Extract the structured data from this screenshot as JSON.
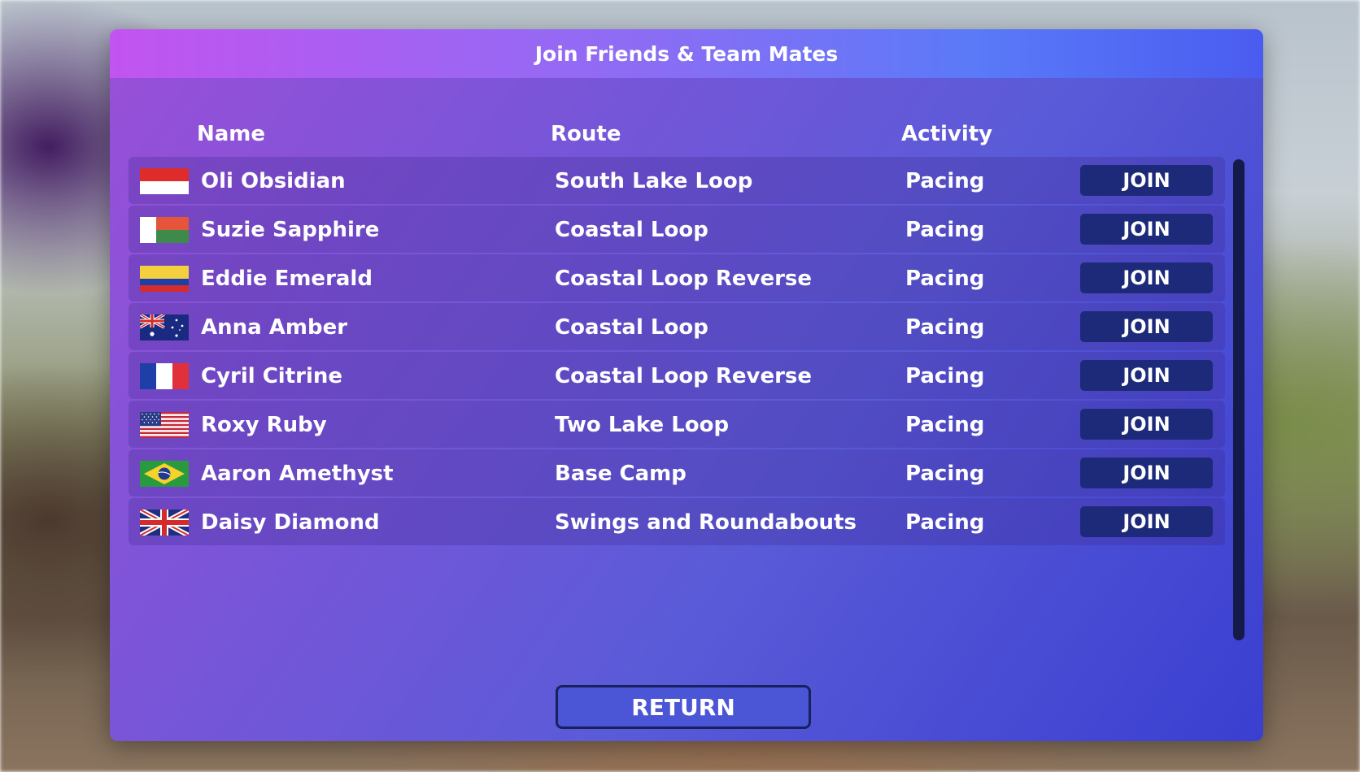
{
  "dialog": {
    "title": "Join Friends & Team Mates",
    "columns": {
      "name": "Name",
      "route": "Route",
      "activity": "Activity"
    },
    "rows": [
      {
        "name": "Oli Obsidian",
        "route": "South Lake Loop",
        "activity": "Pacing",
        "join_label": "JOIN",
        "flag": "indonesia-flag-icon"
      },
      {
        "name": "Suzie Sapphire",
        "route": "Coastal Loop",
        "activity": "Pacing",
        "join_label": "JOIN",
        "flag": "madagascar-flag-icon"
      },
      {
        "name": "Eddie Emerald",
        "route": "Coastal Loop Reverse",
        "activity": "Pacing",
        "join_label": "JOIN",
        "flag": "colombia-flag-icon"
      },
      {
        "name": "Anna Amber",
        "route": "Coastal Loop",
        "activity": "Pacing",
        "join_label": "JOIN",
        "flag": "australia-flag-icon"
      },
      {
        "name": "Cyril Citrine",
        "route": "Coastal Loop Reverse",
        "activity": "Pacing",
        "join_label": "JOIN",
        "flag": "france-flag-icon"
      },
      {
        "name": "Roxy Ruby",
        "route": "Two Lake Loop",
        "activity": "Pacing",
        "join_label": "JOIN",
        "flag": "usa-flag-icon"
      },
      {
        "name": "Aaron Amethyst",
        "route": "Base Camp",
        "activity": "Pacing",
        "join_label": "JOIN",
        "flag": "brazil-flag-icon"
      },
      {
        "name": "Daisy Diamond",
        "route": "Swings and Roundabouts",
        "activity": "Pacing",
        "join_label": "JOIN",
        "flag": "uk-flag-icon"
      }
    ],
    "return_label": "RETURN"
  },
  "colors": {
    "join_button": "#1d2a7a",
    "return_border": "#16215e",
    "scrollbar": "#141a4a"
  }
}
